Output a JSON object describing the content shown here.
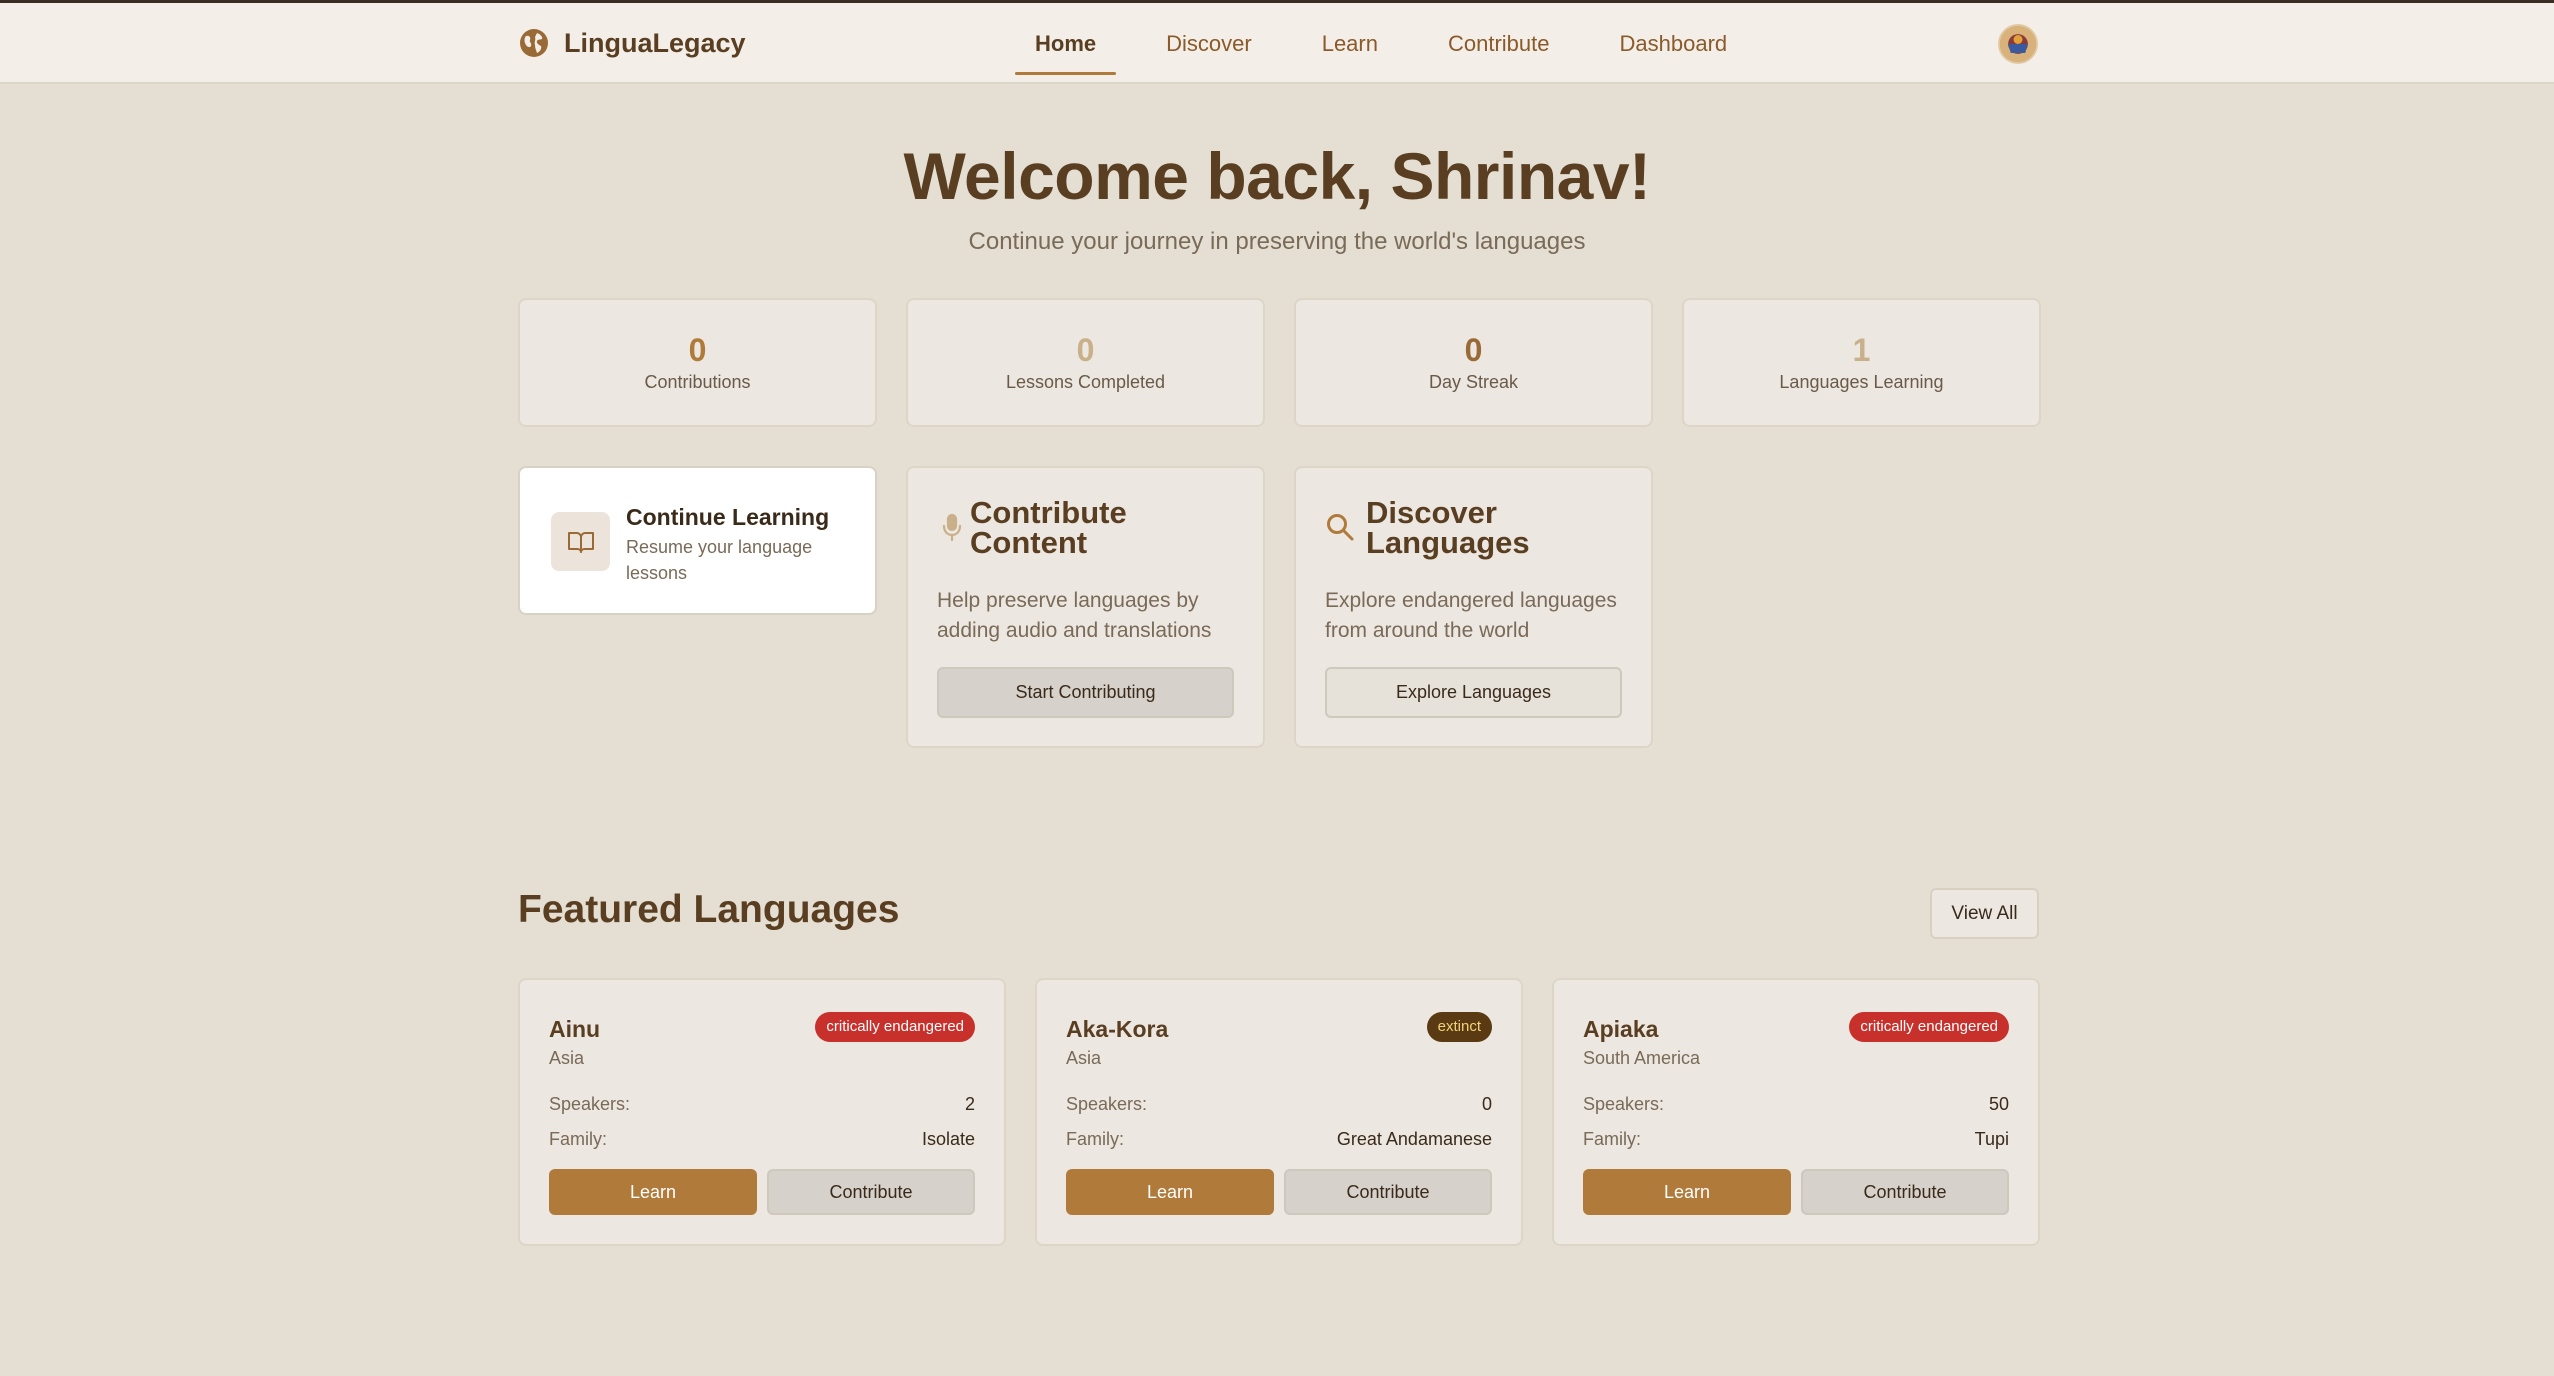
{
  "app": {
    "name": "LinguaLegacy",
    "logo_icon": "globe-icon",
    "avatar_icon": "user-avatar"
  },
  "nav": {
    "items": [
      {
        "label": "Home",
        "active": true
      },
      {
        "label": "Discover",
        "active": false
      },
      {
        "label": "Learn",
        "active": false
      },
      {
        "label": "Contribute",
        "active": false
      },
      {
        "label": "Dashboard",
        "active": false
      }
    ]
  },
  "hero": {
    "title": "Welcome back, Shrinav!",
    "subtitle": "Continue your journey in preserving the world's languages"
  },
  "stats": [
    {
      "value": "0",
      "label": "Contributions",
      "color": "#b07a3a"
    },
    {
      "value": "0",
      "label": "Lessons Completed",
      "color": "#c9b08a"
    },
    {
      "value": "0",
      "label": "Day Streak",
      "color": "#9a6a36"
    },
    {
      "value": "1",
      "label": "Languages Learning",
      "color": "#c9b08a"
    }
  ],
  "actions": {
    "continue_learning": {
      "title": "Continue Learning",
      "description": "Resume your language lessons",
      "icon": "book-open-icon"
    },
    "contribute": {
      "title": "Contribute Content",
      "description": "Help preserve languages by adding audio and translations",
      "button": "Start Contributing",
      "icon": "microphone-icon"
    },
    "discover": {
      "title": "Discover Languages",
      "description": "Explore endangered languages from around the world",
      "button": "Explore Languages",
      "icon": "search-icon"
    }
  },
  "featured": {
    "title": "Featured Languages",
    "view_all": "View All",
    "speakers_label": "Speakers:",
    "family_label": "Family:",
    "learn_label": "Learn",
    "contribute_label": "Contribute",
    "languages": [
      {
        "name": "Ainu",
        "region": "Asia",
        "status": "critically endangered",
        "speakers": "2",
        "family": "Isolate"
      },
      {
        "name": "Aka-Kora",
        "region": "Asia",
        "status": "extinct",
        "speakers": "0",
        "family": "Great Andamanese"
      },
      {
        "name": "Apiaka",
        "region": "South America",
        "status": "critically endangered",
        "speakers": "50",
        "family": "Tupi"
      }
    ]
  },
  "colors": {
    "accent": "#b07a3a",
    "heading": "#5a3e22",
    "background": "#e4dfd2",
    "critically_endangered": "#c8302c",
    "extinct": "#5a3a12"
  }
}
